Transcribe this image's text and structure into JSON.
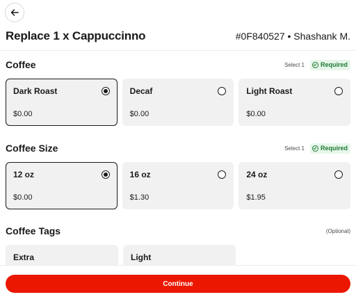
{
  "header": {
    "back_icon": "arrow-left-icon",
    "title": "Replace 1 x Cappuccinno",
    "order_info": "#0F840527 • Shashank M."
  },
  "sections": [
    {
      "title": "Coffee",
      "select_note": "Select 1",
      "required_label": "Required",
      "options": [
        {
          "name": "Dark Roast",
          "price": "$0.00",
          "selected": true
        },
        {
          "name": "Decaf",
          "price": "$0.00",
          "selected": false
        },
        {
          "name": "Light Roast",
          "price": "$0.00",
          "selected": false
        }
      ]
    },
    {
      "title": "Coffee Size",
      "select_note": "Select 1",
      "required_label": "Required",
      "options": [
        {
          "name": "12 oz",
          "price": "$0.00",
          "selected": true
        },
        {
          "name": "16 oz",
          "price": "$1.30",
          "selected": false
        },
        {
          "name": "24 oz",
          "price": "$1.95",
          "selected": false
        }
      ]
    },
    {
      "title": "Coffee Tags",
      "optional_label": "(Optional)",
      "options": [
        {
          "name": "Extra"
        },
        {
          "name": "Light"
        }
      ]
    }
  ],
  "footer": {
    "continue_label": "Continue"
  },
  "colors": {
    "accent": "#eb1700",
    "required_bg": "#e7f6ea",
    "required_text": "#1e7a34",
    "card_bg": "#f1f1f1"
  }
}
